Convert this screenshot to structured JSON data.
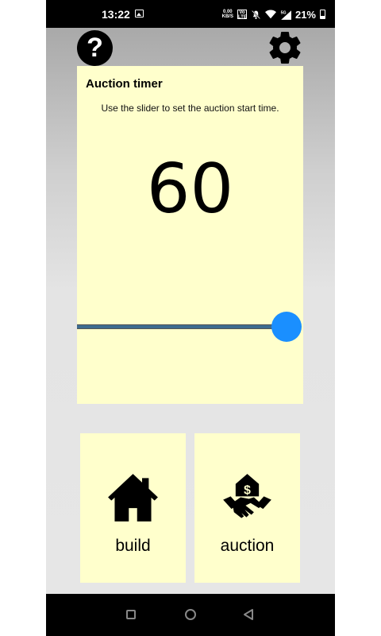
{
  "status_bar": {
    "time": "13:22",
    "speed_top": "0.00",
    "speed_bottom": "KB/S",
    "sim_top": "Vo",
    "sim_bottom": "LTE",
    "battery_percent": "21%",
    "icons": [
      "image-icon",
      "network-speed-indicator",
      "volte-icon",
      "mute-icon",
      "wifi-icon",
      "5g-signal-icon",
      "battery-icon"
    ]
  },
  "header": {
    "help_label": "?",
    "help_icon": "question-mark-icon",
    "settings_icon": "gear-icon"
  },
  "timer_card": {
    "title": "Auction timer",
    "description": "Use the slider to set the auction start time.",
    "value": "60",
    "slider_level": 1.0,
    "slider_color": "#1a8fff",
    "track_color": "#3d6b8f",
    "card_color": "#ffffcc"
  },
  "modes": [
    {
      "label": "build",
      "icon": "house-icon"
    },
    {
      "label": "auction",
      "icon": "handshake-house-dollar-icon"
    }
  ],
  "nav_bar": {
    "icons": [
      "recent-apps-icon",
      "home-icon",
      "back-icon"
    ]
  }
}
